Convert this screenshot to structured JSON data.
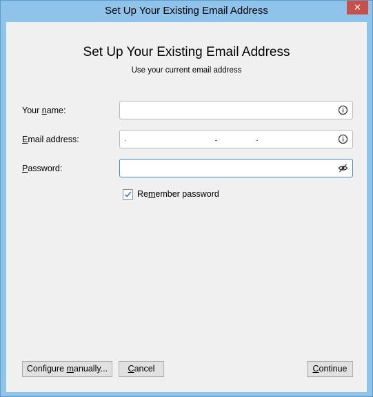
{
  "window": {
    "title": "Set Up Your Existing Email Address",
    "close_glyph": "✕"
  },
  "header": {
    "title": "Set Up Your Existing Email Address",
    "subtitle": "Use your current email address"
  },
  "form": {
    "name": {
      "label_pre": "Your ",
      "label_accel": "n",
      "label_post": "ame:",
      "value": "",
      "icon": "info-icon"
    },
    "email": {
      "label_pre": "",
      "label_accel": "E",
      "label_post": "mail address:",
      "value": "",
      "icon": "info-icon"
    },
    "password": {
      "label_pre": "",
      "label_accel": "P",
      "label_post": "assword:",
      "value": "",
      "icon": "eye-slash-icon"
    },
    "remember": {
      "label_pre": "Re",
      "label_accel": "m",
      "label_post": "ember password",
      "checked": true
    }
  },
  "buttons": {
    "configure": {
      "pre": "Configure ",
      "accel": "m",
      "post": "anually..."
    },
    "cancel": {
      "pre": "",
      "accel": "C",
      "post": "ancel"
    },
    "continue": {
      "pre": "",
      "accel": "C",
      "post": "ontinue"
    }
  },
  "colors": {
    "frame": "#8fc3ea",
    "close_button": "#c7504a",
    "focus_border": "#3e86d0",
    "check_mark": "#2a6fbf"
  }
}
